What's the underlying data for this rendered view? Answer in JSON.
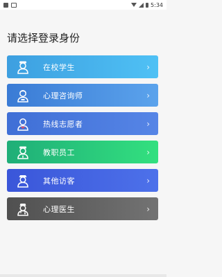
{
  "status_bar": {
    "time": "5:34"
  },
  "page": {
    "title": "请选择登录身份"
  },
  "roles": [
    {
      "label": "在校学生",
      "icon": "student-avatar-icon"
    },
    {
      "label": "心理咨询师",
      "icon": "counselor-avatar-icon"
    },
    {
      "label": "热线志愿者",
      "icon": "volunteer-avatar-icon"
    },
    {
      "label": "教职员工",
      "icon": "staff-avatar-icon"
    },
    {
      "label": "其他访客",
      "icon": "visitor-avatar-icon"
    },
    {
      "label": "心理医生",
      "icon": "doctor-avatar-icon"
    }
  ],
  "colors": {
    "student": "#4fc1f5",
    "counselor": "#5ba3ec",
    "volunteer": "#5685e6",
    "staff": "#33e07f",
    "visitor": "#4d71ea",
    "doctor": "#737373"
  },
  "chevron": "›"
}
